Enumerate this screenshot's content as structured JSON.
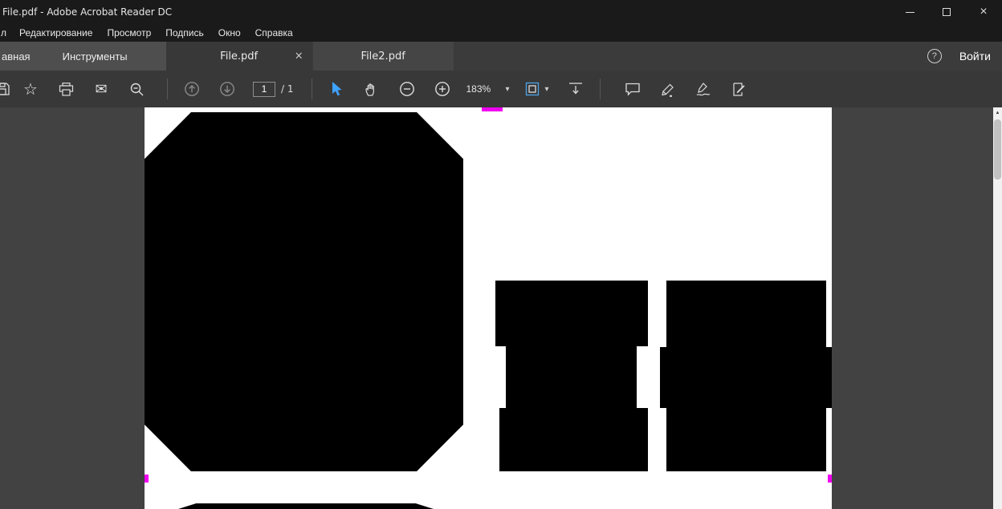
{
  "colors": {
    "accent_blue": "#3fa2ff",
    "page_fit_blue": "#4da3e8",
    "annotation_magenta": "#f000f0",
    "redaction_black": "#000000",
    "page_white": "#ffffff",
    "chrome_dark": "#1a1a1a",
    "toolbar_gray": "#383838"
  },
  "window": {
    "title": "File.pdf - Adobe Acrobat Reader DC"
  },
  "menubar": {
    "items": [
      "л",
      "Редактирование",
      "Просмотр",
      "Подпись",
      "Окно",
      "Справка"
    ]
  },
  "tabbar": {
    "home_label": "авная",
    "tools_label": "Инструменты",
    "doc_tabs": [
      {
        "label": "File.pdf"
      },
      {
        "label": "File2.pdf"
      }
    ],
    "help_glyph": "?",
    "sign_in_label": "Войти"
  },
  "toolbar": {
    "page_current": "1",
    "page_total_label": "/ 1",
    "zoom_level": "183%"
  },
  "icons": {
    "star": "☆",
    "envelope": "✉",
    "caret_down": "▾",
    "close": "×",
    "tab_close": "×",
    "scrollbar_up": "▲"
  }
}
